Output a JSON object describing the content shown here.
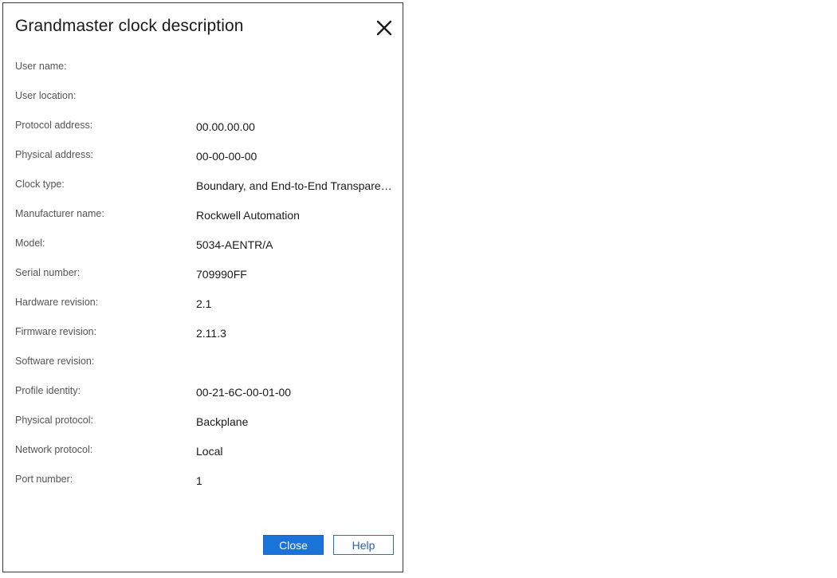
{
  "dialog": {
    "title": "Grandmaster clock description",
    "close_icon": "close-icon",
    "rows": [
      {
        "label": "User name:",
        "value": ""
      },
      {
        "label": "User location:",
        "value": ""
      },
      {
        "label": "Protocol address:",
        "value": "00.00.00.00"
      },
      {
        "label": "Physical address:",
        "value": "00-00-00-00"
      },
      {
        "label": "Clock type:",
        "value": "Boundary, and End-to-End Transpare…"
      },
      {
        "label": "Manufacturer name:",
        "value": "Rockwell Automation"
      },
      {
        "label": "Model:",
        "value": "5034-AENTR/A"
      },
      {
        "label": "Serial number:",
        "value": "709990FF"
      },
      {
        "label": "Hardware revision:",
        "value": "2.1"
      },
      {
        "label": "Firmware revision:",
        "value": "2.11.3"
      },
      {
        "label": "Software revision:",
        "value": ""
      },
      {
        "label": "Profile identity:",
        "value": "00-21-6C-00-01-00"
      },
      {
        "label": "Physical protocol:",
        "value": "Backplane"
      },
      {
        "label": "Network protocol:",
        "value": "Local"
      },
      {
        "label": "Port number:",
        "value": "1"
      }
    ],
    "buttons": {
      "close_label": "Close",
      "help_label": "Help"
    },
    "colors": {
      "primary_button": "#1a73d9",
      "help_button_border": "#2b6fcc"
    }
  }
}
